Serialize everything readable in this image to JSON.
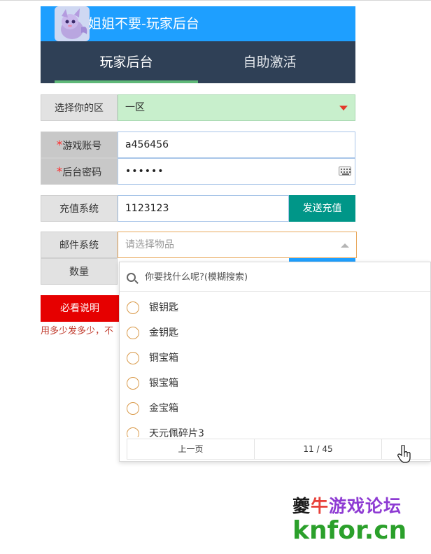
{
  "header": {
    "title": "姐姐不要-玩家后台"
  },
  "tabs": [
    {
      "label": "玩家后台",
      "active": true
    },
    {
      "label": "自助激活",
      "active": false
    }
  ],
  "form": {
    "region": {
      "label": "选择你的区",
      "value": "一区"
    },
    "account": {
      "required_mark": "*",
      "label": "游戏账号",
      "value": "a456456"
    },
    "password": {
      "required_mark": "*",
      "label": "后台密码",
      "value": "••••••"
    },
    "recharge": {
      "label": "充值系统",
      "value": "1123123",
      "button": "发送充值"
    },
    "mail": {
      "label": "邮件系统",
      "placeholder": "请选择物品"
    },
    "quantity": {
      "label": "数量"
    }
  },
  "instructions_button": "必看说明",
  "notice": "用多少发多少，不",
  "dropdown": {
    "search_placeholder": "你要找什么呢?(模糊搜索)",
    "items": [
      "银钥匙",
      "金钥匙",
      "铜宝箱",
      "银宝箱",
      "金宝箱",
      "天元佩碎片3"
    ],
    "pager": {
      "prev": "上一页",
      "info": "11 / 45",
      "next": ""
    }
  },
  "watermark": {
    "line1_a": "夔",
    "line1_b": "牛",
    "line1_c": "游戏论坛",
    "line2": "knfor.cn"
  },
  "colors": {
    "header_blue": "#1e9fff",
    "tab_bar": "#2f4056",
    "tab_indicator": "#5fb878",
    "region_green": "#c8efcc",
    "send_button": "#009688",
    "instructions_red": "#e60000"
  }
}
